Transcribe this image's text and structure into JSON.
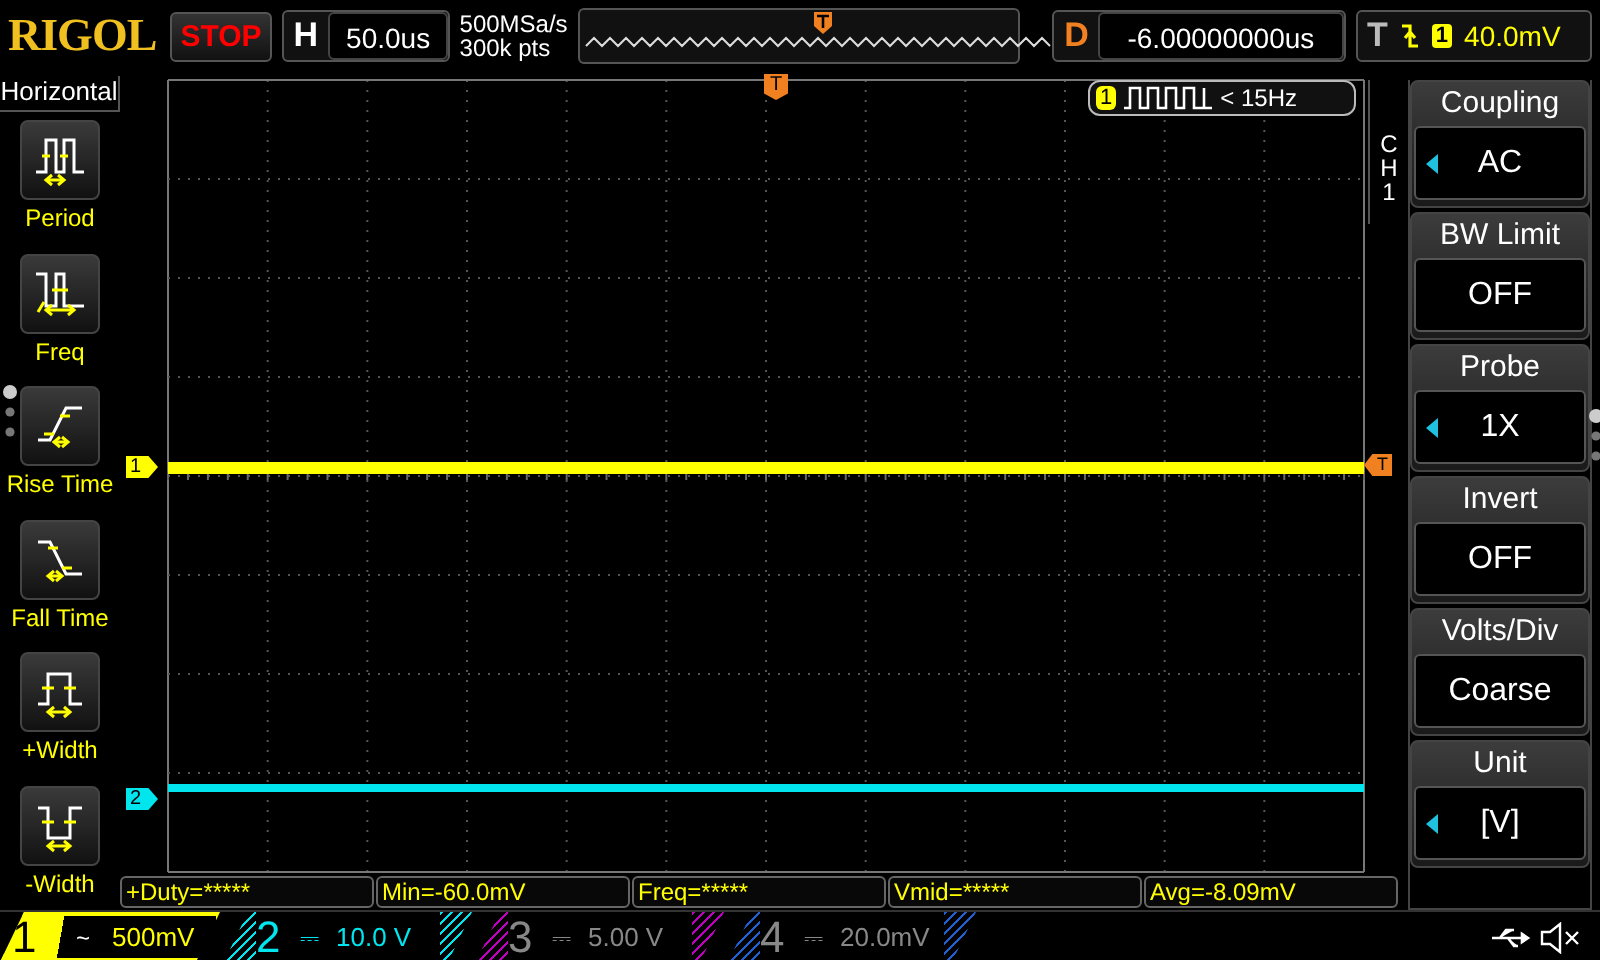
{
  "brand": "RIGOL",
  "run_state": "STOP",
  "horizontal": {
    "label": "H",
    "value": "50.0us"
  },
  "sampling": {
    "rate": "500MSa/s",
    "depth": "300k pts"
  },
  "delay": {
    "label": "D",
    "value": "-6.00000000us"
  },
  "trigger": {
    "label": "T",
    "source": "1",
    "level": "40.0mV"
  },
  "frequency_counter": {
    "channel": "1",
    "value": "< 15Hz"
  },
  "trigger_position_marker": "T",
  "trigger_level_marker": "T",
  "left_menu": {
    "title": "Horizontal",
    "items": [
      {
        "label": "Period",
        "kind": "period"
      },
      {
        "label": "Freq",
        "kind": "freq"
      },
      {
        "label": "Rise Time",
        "kind": "rise"
      },
      {
        "label": "Fall Time",
        "kind": "fall"
      },
      {
        "label": "+Width",
        "kind": "pwidth"
      },
      {
        "label": "-Width",
        "kind": "nwidth"
      }
    ]
  },
  "traces": [
    {
      "label": "1",
      "color": "#ffff00"
    },
    {
      "label": "2",
      "color": "#00e5ee"
    }
  ],
  "right_menu": {
    "channel": "CH1",
    "items": [
      {
        "label": "Coupling",
        "value": "AC",
        "adjustable": true
      },
      {
        "label": "BW Limit",
        "value": "OFF",
        "adjustable": false
      },
      {
        "label": "Probe",
        "value": "1X",
        "adjustable": true
      },
      {
        "label": "Invert",
        "value": "OFF",
        "adjustable": false
      },
      {
        "label": "Volts/Div",
        "value": "Coarse",
        "adjustable": false
      },
      {
        "label": "Unit",
        "value": "[V]",
        "adjustable": true
      }
    ]
  },
  "measurements": [
    "+Duty=*****",
    "Min=-60.0mV",
    "Freq=*****",
    "Vmid=*****",
    "Avg=-8.09mV"
  ],
  "channels": [
    {
      "label": "1",
      "coupling": "~",
      "scale": "500mV",
      "color": "#ffff00",
      "on": true,
      "selected": true
    },
    {
      "label": "2",
      "coupling": "⎓",
      "scale": "10.0 V",
      "color": "#00e5ee",
      "on": true,
      "selected": false
    },
    {
      "label": "3",
      "coupling": "⎓",
      "scale": "5.00 V",
      "color": "#c000c0",
      "on": false,
      "selected": false
    },
    {
      "label": "4",
      "coupling": "⎓",
      "scale": "20.0mV",
      "color": "#2060d0",
      "on": false,
      "selected": false
    }
  ]
}
